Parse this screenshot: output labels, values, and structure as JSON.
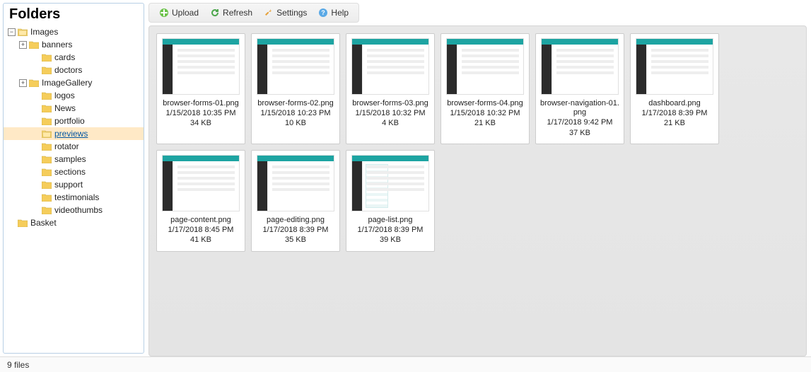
{
  "sidebar": {
    "title": "Folders",
    "items": [
      {
        "label": "Images",
        "indent": 0,
        "expander": "−",
        "open": true
      },
      {
        "label": "banners",
        "indent": 1,
        "expander": "+"
      },
      {
        "label": "cards",
        "indent": 2,
        "expander": ""
      },
      {
        "label": "doctors",
        "indent": 2,
        "expander": ""
      },
      {
        "label": "ImageGallery",
        "indent": 1,
        "expander": "+"
      },
      {
        "label": "logos",
        "indent": 2,
        "expander": ""
      },
      {
        "label": "News",
        "indent": 2,
        "expander": ""
      },
      {
        "label": "portfolio",
        "indent": 2,
        "expander": ""
      },
      {
        "label": "previews",
        "indent": 2,
        "expander": "",
        "selected": true
      },
      {
        "label": "rotator",
        "indent": 2,
        "expander": ""
      },
      {
        "label": "samples",
        "indent": 2,
        "expander": ""
      },
      {
        "label": "sections",
        "indent": 2,
        "expander": ""
      },
      {
        "label": "support",
        "indent": 2,
        "expander": ""
      },
      {
        "label": "testimonials",
        "indent": 2,
        "expander": ""
      },
      {
        "label": "videothumbs",
        "indent": 2,
        "expander": ""
      },
      {
        "label": "Basket",
        "indent": 0,
        "expander": ""
      }
    ]
  },
  "toolbar": {
    "upload": "Upload",
    "refresh": "Refresh",
    "settings": "Settings",
    "help": "Help"
  },
  "files": [
    {
      "name": "browser-forms-01.png",
      "date": "1/15/2018 10:35 PM",
      "size": "34 KB",
      "variant": ""
    },
    {
      "name": "browser-forms-02.png",
      "date": "1/15/2018 10:23 PM",
      "size": "10 KB",
      "variant": ""
    },
    {
      "name": "browser-forms-03.png",
      "date": "1/15/2018 10:32 PM",
      "size": "4 KB",
      "variant": ""
    },
    {
      "name": "browser-forms-04.png",
      "date": "1/15/2018 10:32 PM",
      "size": "21 KB",
      "variant": ""
    },
    {
      "name": "browser-navigation-01.png",
      "date": "1/17/2018 9:42 PM",
      "size": "37 KB",
      "variant": ""
    },
    {
      "name": "dashboard.png",
      "date": "1/17/2018 8:39 PM",
      "size": "21 KB",
      "variant": ""
    },
    {
      "name": "page-content.png",
      "date": "1/17/2018 8:45 PM",
      "size": "41 KB",
      "variant": ""
    },
    {
      "name": "page-editing.png",
      "date": "1/17/2018 8:39 PM",
      "size": "35 KB",
      "variant": ""
    },
    {
      "name": "page-list.png",
      "date": "1/17/2018 8:39 PM",
      "size": "39 KB",
      "variant": "sidebar"
    }
  ],
  "status": {
    "text": "9 files"
  }
}
